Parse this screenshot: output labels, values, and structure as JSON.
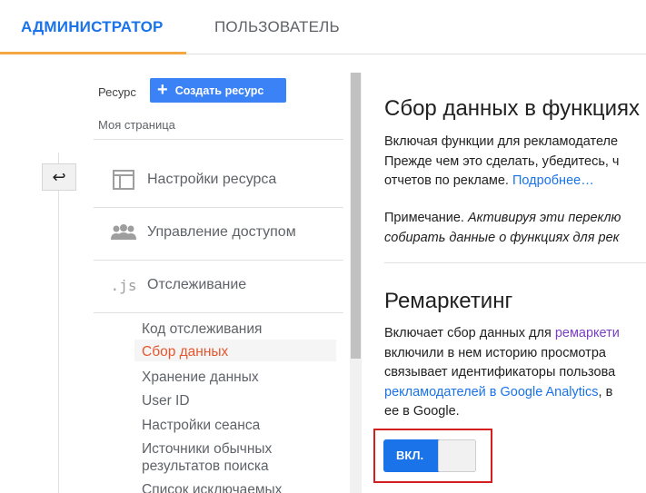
{
  "tabs": {
    "admin": "АДМИНИСТРАТОР",
    "user": "ПОЛЬЗОВАТЕЛЬ"
  },
  "nav": {
    "resource_label": "Ресурс",
    "create_button": "Создать ресурс",
    "my_page": "Моя страница",
    "sections": [
      {
        "label": "Настройки ресурса",
        "icon": "panel-layout-icon"
      },
      {
        "label": "Управление доступом",
        "icon": "people-icon"
      },
      {
        "label": "Отслеживание",
        "icon": "js-icon",
        "icon_text": ".js"
      }
    ],
    "sub_items": [
      "Код отслеживания",
      "Сбор данных",
      "Хранение данных",
      "User ID",
      "Настройки сеанса",
      "Источники обычных",
      "результатов поиска",
      "Список исключаемых"
    ],
    "active_sub_item": "Сбор данных"
  },
  "content": {
    "section1": {
      "title": "Сбор данных в функциях",
      "line1": "Включая функции для рекламодателе",
      "line2": "Прежде чем это сделать, убедитесь, ч",
      "line3_text": "отчетов по рекламе. ",
      "line3_link": "Подробнее…",
      "note_label": "Примечание. ",
      "note_text": "Активируя эти переклю",
      "note_line2": "собирать данные о функциях для рек"
    },
    "section2": {
      "title": "Ремаркетинг",
      "line1_text": "Включает сбор данных для ",
      "line1_link": "ремаркети",
      "line2": "включили в нем историю просмотра",
      "line3": "связывает идентификаторы пользова",
      "line4_link": "рекламодателей в Google Analytics",
      "line4_text": ", в",
      "line5": "ее в Google."
    },
    "toggle": {
      "state": "on",
      "label": "ВКЛ."
    }
  },
  "colors": {
    "accent_blue": "#1a73e8",
    "tab_underline": "#f5a742",
    "active_item": "#e4572e",
    "highlight_border": "#d51f1f"
  }
}
